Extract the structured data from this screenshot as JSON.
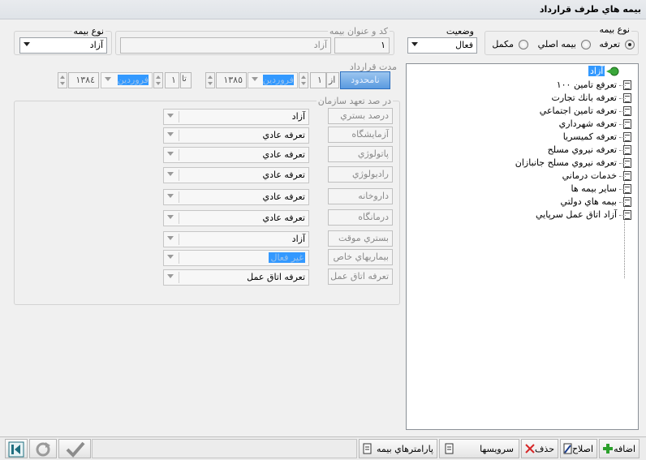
{
  "window": {
    "title": "بيمه هاي طرف قرارداد"
  },
  "insurance_kind": {
    "label": "نوع بيمه",
    "options": [
      "تعرفه",
      "بيمه اصلي",
      "مكمل"
    ],
    "selected": "تعرفه"
  },
  "status": {
    "label": "وضعيت",
    "value": "فعال"
  },
  "code_title": {
    "label": "كد و عنوان بيمه",
    "code": "١",
    "title": "آزاد"
  },
  "insurance_type_right": {
    "label": "نوع بيمه",
    "value": "آزاد"
  },
  "contract": {
    "label": "مدت قرارداد",
    "unlimited_button": "نامحدود",
    "from_label": "از",
    "from_day": "١",
    "from_month": "فروردين",
    "from_year": "١٣٨٥",
    "to_label": "تا",
    "to_day": "١",
    "to_month": "فروردين",
    "to_year": "١٣٨٤"
  },
  "commitment": {
    "label": "در صد تعهد سازمان",
    "rows": [
      {
        "label": "درصد بستري",
        "value": "آزاد"
      },
      {
        "label": "آزمايشگاه",
        "value": "تعرفه عادي"
      },
      {
        "label": "پاتولوژي",
        "value": "تعرفه عادي"
      },
      {
        "label": "راديولوژي",
        "value": "تعرفه عادي"
      },
      {
        "label": "داروخانه",
        "value": "تعرفه عادي"
      },
      {
        "label": "درمانگاه",
        "value": "تعرفه عادي"
      },
      {
        "label": "بستري موقت",
        "value": "آزاد"
      },
      {
        "label": "بيماريهاي خاص",
        "value": "غير فعال"
      },
      {
        "label": "تعرفه اتاق عمل",
        "value": "تعرفه اتاق عمل"
      }
    ]
  },
  "tree": {
    "root": "آزاد",
    "items": [
      "تعرفع تامين ١٠٠",
      "تعرفه بانك تجارت",
      "تعرفه تامين اجتماعي",
      "تعرفه شهرداري",
      "تعرفه كميسريا",
      "تعرفه نيروي مسلح",
      "تعرفه نيروي مسلح جانبازان",
      "خدمات درماني",
      "ساير بيمه ها",
      "بيمه هاي دولتي",
      "آزاد اتاق عمل سرپايي"
    ]
  },
  "toolbar": {
    "add": "اضافه",
    "edit": "اصلاح",
    "delete": "حذف",
    "services": "سرويسها",
    "params": "پارامترهاي بيمه"
  },
  "colors": {
    "selection": "#3399ff",
    "add_icon": "#2ca02c",
    "delete_icon": "#d62728"
  }
}
